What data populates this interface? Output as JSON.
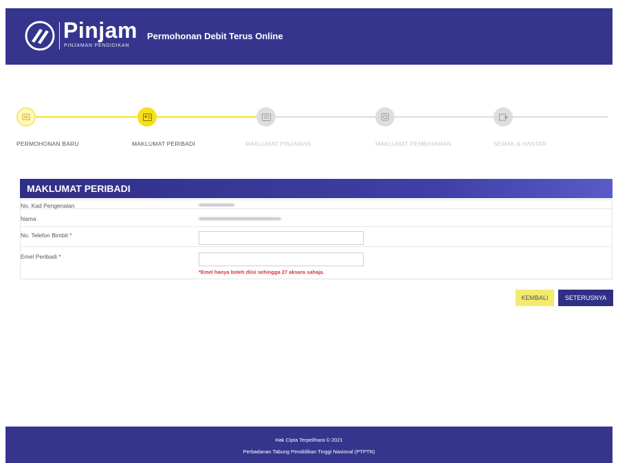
{
  "header": {
    "logo_text": "Pinjam",
    "logo_subtitle": "PINJAMAN PENDIDIKAN",
    "title": "Permohonan Debit Terus Online"
  },
  "stepper": {
    "steps": [
      {
        "label": "PERMOHONAN BARU",
        "icon": "form-icon",
        "state": "done"
      },
      {
        "label": "MAKLUMAT PERIBADI",
        "icon": "id-card-icon",
        "state": "active"
      },
      {
        "label": "MAKLUMAT PINJAMAN",
        "icon": "document-icon",
        "state": "pending"
      },
      {
        "label": "MAKLUMAT PEMBAYARAN",
        "icon": "payment-icon",
        "state": "pending"
      },
      {
        "label": "SEMAK & HANTAR",
        "icon": "send-icon",
        "state": "pending"
      }
    ],
    "colors": {
      "done": "#f3ea6e",
      "active": "#f6df1b",
      "pending": "#d9d9d9"
    }
  },
  "form": {
    "title": "MAKLUMAT PERIBADI",
    "rows": [
      {
        "label": "No. Kad Pengenalan"
      },
      {
        "label": "Nama"
      },
      {
        "label": "No. Telefon Bimbit *",
        "value": ""
      },
      {
        "label": "Emel Peribadi *",
        "value": ""
      }
    ],
    "email_error": "*Emel hanya boleh diisi sehingga 27 aksara sahaja."
  },
  "buttons": {
    "back": "KEMBALI",
    "next": "SETERUSNYA"
  },
  "footer": {
    "line1": "Hak Cipta Terpelihara © 2021",
    "line2": "Perbadanan Tabung Pendidikan Tinggi Nasional (PTPTN)"
  },
  "colors": {
    "brand": "#35358e",
    "accent": "#f6df1b",
    "error": "#e03030"
  }
}
